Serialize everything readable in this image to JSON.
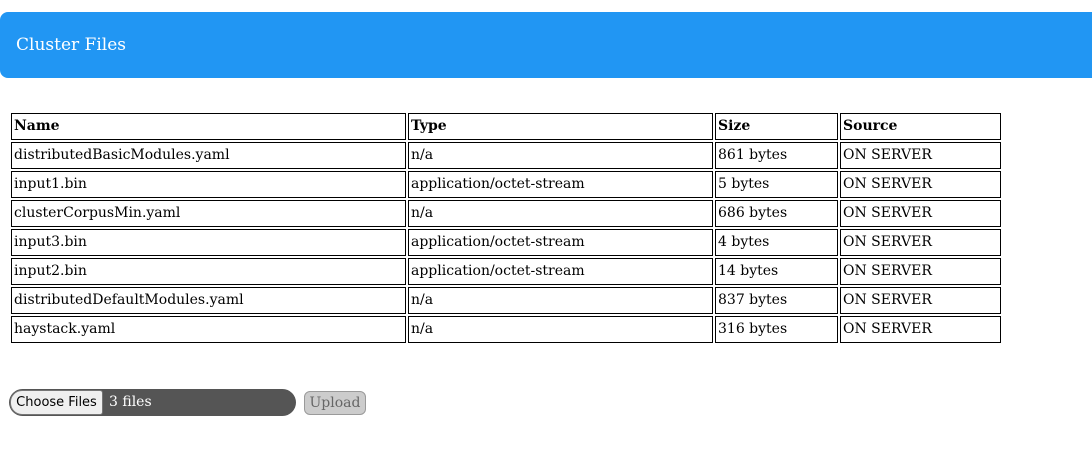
{
  "header": {
    "title": "Cluster Files",
    "background": "#2196f3"
  },
  "table": {
    "columns": [
      "Name",
      "Type",
      "Size",
      "Source"
    ],
    "rows": [
      {
        "name": "distributedBasicModules.yaml",
        "type": "n/a",
        "size": "861 bytes",
        "source": "ON SERVER"
      },
      {
        "name": "input1.bin",
        "type": "application/octet-stream",
        "size": "5 bytes",
        "source": "ON SERVER"
      },
      {
        "name": "clusterCorpusMin.yaml",
        "type": "n/a",
        "size": "686 bytes",
        "source": "ON SERVER"
      },
      {
        "name": "input3.bin",
        "type": "application/octet-stream",
        "size": "4 bytes",
        "source": "ON SERVER"
      },
      {
        "name": "input2.bin",
        "type": "application/octet-stream",
        "size": "14 bytes",
        "source": "ON SERVER"
      },
      {
        "name": "distributedDefaultModules.yaml",
        "type": "n/a",
        "size": "837 bytes",
        "source": "ON SERVER"
      },
      {
        "name": "haystack.yaml",
        "type": "n/a",
        "size": "316 bytes",
        "source": "ON SERVER"
      }
    ]
  },
  "upload": {
    "choose_label": "Choose Files",
    "selected_text": "3 files",
    "upload_label": "Upload"
  }
}
